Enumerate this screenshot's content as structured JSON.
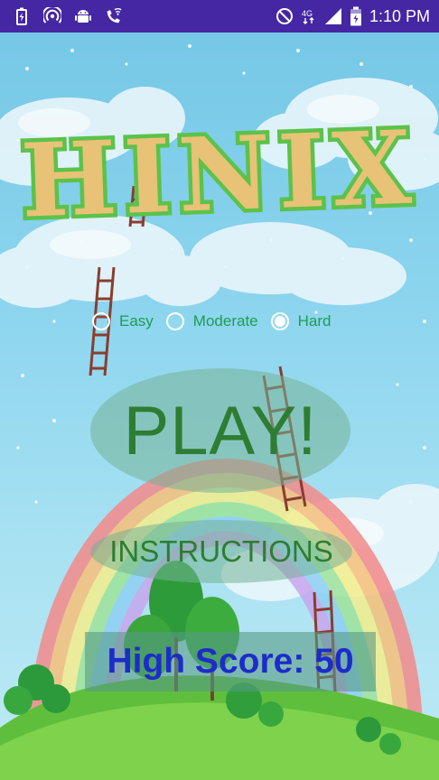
{
  "status_bar": {
    "time": "1:10 PM",
    "left_icons": [
      "battery-charging-icon",
      "wireless-icon",
      "android-icon",
      "phone-wifi-icon"
    ],
    "right_icons": [
      "do-not-disturb-icon",
      "network-4g-icon",
      "signal-icon",
      "battery-icon"
    ],
    "network_label": "4G"
  },
  "app": {
    "title": "HINIX",
    "difficulty": {
      "options": [
        {
          "label": "Easy",
          "selected": false
        },
        {
          "label": "Moderate",
          "selected": false
        },
        {
          "label": "Hard",
          "selected": true
        }
      ]
    },
    "play_label": "PLAY!",
    "instructions_label": "INSTRUCTIONS",
    "high_score": "High Score: 50"
  },
  "colors": {
    "status_bar": "#4526a3",
    "label_green": "#1e9d51",
    "button_text": "#2e7d32",
    "score_text": "#1c2cc9",
    "title_fill": "#e8c277",
    "title_outline": "#5cc24a"
  }
}
